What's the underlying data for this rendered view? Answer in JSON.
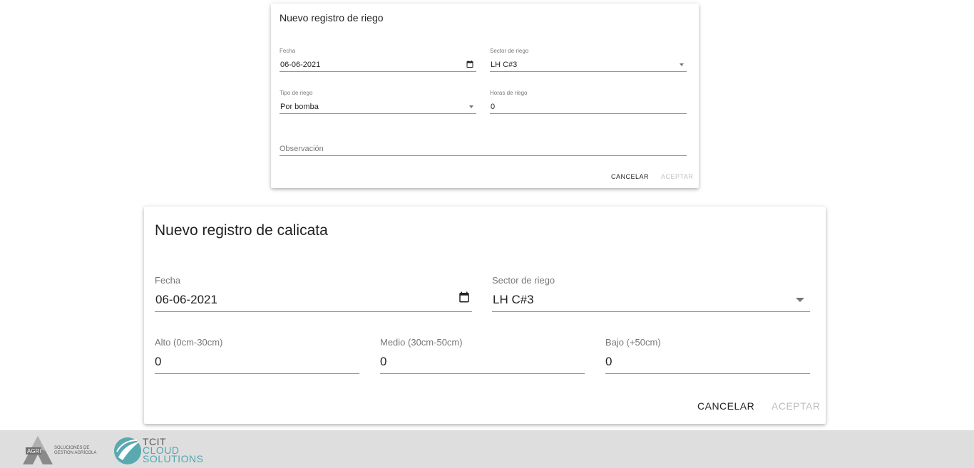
{
  "riego_dialog": {
    "title": "Nuevo registro de riego",
    "fecha": {
      "label": "Fecha",
      "value": "06-06-2021",
      "icon": "calendar-icon"
    },
    "sector": {
      "label": "Sector de riego",
      "value": "LH C#3",
      "icon": "dropdown-caret-icon"
    },
    "tipo": {
      "label": "Tipo de riego",
      "value": "Por bomba",
      "icon": "dropdown-caret-icon"
    },
    "horas": {
      "label": "Horas de riego",
      "value": "0"
    },
    "observacion": {
      "placeholder": "Observación",
      "value": ""
    },
    "cancel_label": "CANCELAR",
    "accept_label": "ACEPTAR"
  },
  "calicata_dialog": {
    "title": "Nuevo registro de calicata",
    "fecha": {
      "label": "Fecha",
      "value": "06-06-2021",
      "icon": "calendar-icon"
    },
    "sector": {
      "label": "Sector de riego",
      "value": "LH C#3",
      "icon": "dropdown-caret-icon"
    },
    "alto": {
      "label": "Alto (0cm-30cm)",
      "value": "0"
    },
    "medio": {
      "label": "Medio (30cm-50cm)",
      "value": "0"
    },
    "bajo": {
      "label": "Bajo (+50cm)",
      "value": "0"
    },
    "cancel_label": "CANCELAR",
    "accept_label": "ACEPTAR"
  },
  "footer": {
    "agri_logo_mark": "AGRI",
    "agri_text_line1": "SOLUCIONES DE",
    "agri_text_line2": "GESTIÓN AGRÍCOLA",
    "tcit_line1": "TCIT",
    "tcit_line2": "CLOUD",
    "tcit_line3": "SOLUTIONS"
  },
  "colors": {
    "footer_bg": "#dedede",
    "tcit_accent": "#4fa7ad",
    "disabled_text": "rgba(0,0,0,0.26)"
  }
}
